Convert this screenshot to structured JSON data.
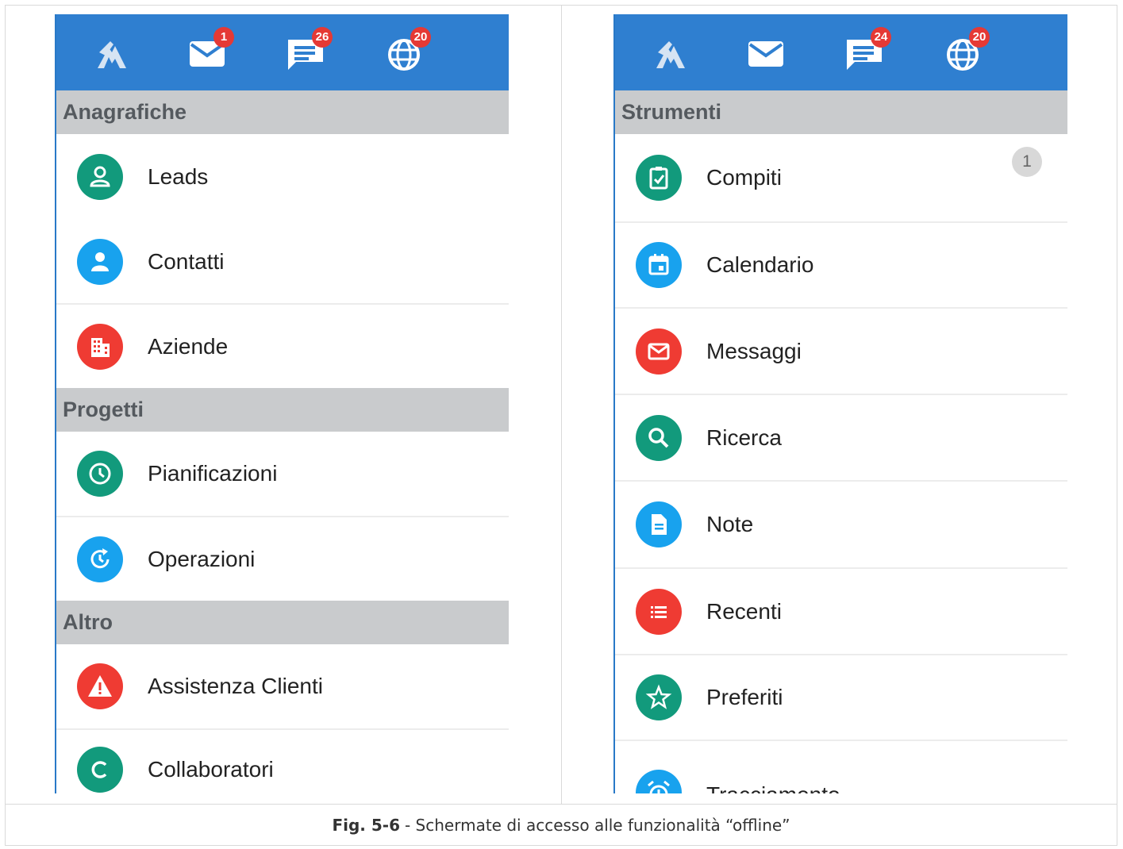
{
  "left_panel": {
    "topbar": {
      "mail_badge": "1",
      "chat_badge": "26",
      "globe_badge": "20"
    },
    "sections": [
      {
        "title": "Anagrafiche",
        "items": [
          "Leads",
          "Contatti",
          "Aziende"
        ]
      },
      {
        "title": "Progetti",
        "items": [
          "Pianificazioni",
          "Operazioni"
        ]
      },
      {
        "title": "Altro",
        "items": [
          "Assistenza Clienti",
          "Collaboratori"
        ]
      }
    ]
  },
  "right_panel": {
    "topbar": {
      "chat_badge": "24",
      "globe_badge": "20"
    },
    "section_title": "Strumenti",
    "items": [
      "Compiti",
      "Calendario",
      "Messaggi",
      "Ricerca",
      "Note",
      "Recenti",
      "Preferiti",
      "Tracciamento"
    ],
    "compiti_count": "1"
  },
  "caption": {
    "label": "Fig. 5-6",
    "text": "- Schermate di accesso alle funzionalità “offline”"
  },
  "colors": {
    "topbar": "#2f7fd0",
    "badge": "#e53935",
    "green": "#129a7c",
    "blue": "#18a2ee",
    "red": "#ef3b33",
    "section_bg": "#c9cbcd"
  },
  "icons": {
    "topbar": [
      "home-icon",
      "mail-icon",
      "chat-icon",
      "globe-icon"
    ],
    "left": [
      "person-icon",
      "contact-icon",
      "building-icon",
      "clock-icon",
      "refresh-clock-icon",
      "warning-icon",
      "c-letter-icon"
    ],
    "right": [
      "clipboard-check-icon",
      "calendar-icon",
      "mail-icon",
      "search-icon",
      "document-icon",
      "list-icon",
      "star-icon",
      "alarm-icon"
    ]
  }
}
